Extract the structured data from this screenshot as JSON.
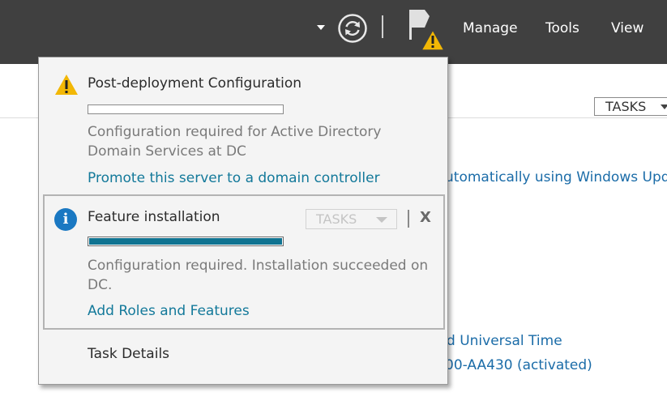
{
  "topbar": {
    "menu": [
      "Manage",
      "Tools",
      "View"
    ]
  },
  "background": {
    "tasks_label": "TASKS",
    "windows_update_text": "utomatically using Windows Update",
    "time_zone_text": "d Universal Time",
    "product_id_text": "00-AA430 (activated)"
  },
  "popup": {
    "notification1": {
      "title": "Post-deployment Configuration",
      "description": "Configuration required for Active Directory Domain Services at DC",
      "link": "Promote this server to a domain controller",
      "progress": 0
    },
    "notification2": {
      "title": "Feature installation",
      "tasks_label": "TASKS",
      "close_label": "X",
      "description": "Configuration required. Installation succeeded on DC.",
      "link": "Add Roles and Features",
      "progress": 1.0
    },
    "task_details": "Task Details"
  },
  "colors": {
    "topbar_bg": "#404040",
    "popup_bg": "#f4f4f4",
    "link": "#13799a",
    "progress_fill": "#0f7391",
    "warning": "#f2b705",
    "info": "#1a78c2"
  },
  "icons": {
    "refresh": "refresh-icon",
    "notifications": "flag-icon",
    "warning": "warning-icon",
    "info": "info-icon",
    "dropdown": "chevron-down-icon"
  }
}
